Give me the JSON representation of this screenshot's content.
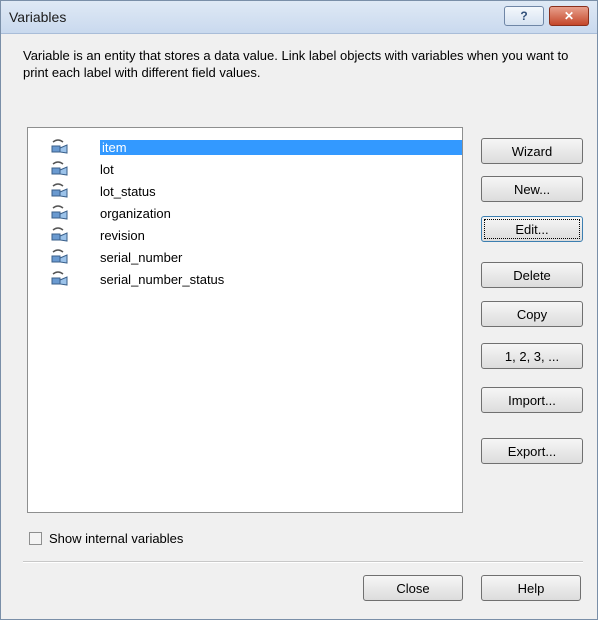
{
  "window": {
    "title": "Variables"
  },
  "titlebar": {
    "help_label": "?",
    "close_label": "✕"
  },
  "description": "Variable is an entity that stores a data value. Link label objects with variables when you want to print each label with different field values.",
  "variables": [
    {
      "label": "item",
      "selected": true
    },
    {
      "label": "lot"
    },
    {
      "label": "lot_status"
    },
    {
      "label": "organization"
    },
    {
      "label": "revision"
    },
    {
      "label": "serial_number"
    },
    {
      "label": "serial_number_status"
    }
  ],
  "buttons": {
    "wizard": "Wizard",
    "new": "New...",
    "edit": "Edit...",
    "delete": "Delete",
    "copy": "Copy",
    "numbering": "1, 2, 3, ...",
    "import": "Import...",
    "export": "Export...",
    "close": "Close",
    "help": "Help"
  },
  "show_internal": {
    "label": "Show internal variables",
    "checked": false
  },
  "icons": {
    "variable": "variable-icon"
  }
}
